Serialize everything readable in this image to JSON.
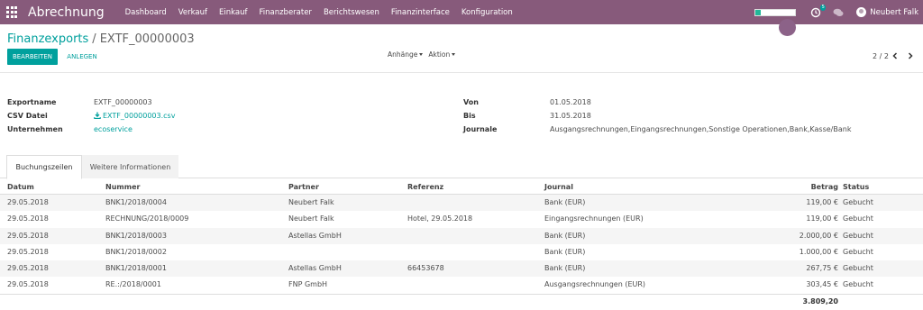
{
  "navbar": {
    "app_title": "Abrechnung",
    "menu": [
      "Dashboard",
      "Verkauf",
      "Einkauf",
      "Finanzberater",
      "Berichtswesen",
      "Finanzinterface",
      "Konfiguration"
    ],
    "activity_badge": "5",
    "progress_fraction": 0.12,
    "user_name": "Neubert Falk",
    "color": "#875a7b"
  },
  "breadcrumb": {
    "parent": "Finanzexports",
    "separator": "/",
    "current": "EXTF_00000003"
  },
  "buttons": {
    "edit": "BEARBEITEN",
    "create": "ANLEGEN"
  },
  "dropdowns": {
    "attachments": "Anhänge",
    "action": "Aktion"
  },
  "pager": {
    "value": "2 / 2"
  },
  "form": {
    "left": [
      {
        "label": "Exportname",
        "value": "EXTF_00000003"
      },
      {
        "label": "CSV Datei",
        "value": "EXTF_00000003.csv"
      },
      {
        "label": "Unternehmen",
        "value": "ecoservice"
      }
    ],
    "right": [
      {
        "label": "Von",
        "value": "01.05.2018"
      },
      {
        "label": "Bis",
        "value": "31.05.2018"
      },
      {
        "label": "Journale",
        "value": "Ausgangsrechnungen,Eingangsrechnungen,Sonstige Operationen,Bank,Kasse/Bank"
      }
    ]
  },
  "tabs": [
    "Buchungszeilen",
    "Weitere Informationen"
  ],
  "table": {
    "headers": {
      "datum": "Datum",
      "nummer": "Nummer",
      "partner": "Partner",
      "referenz": "Referenz",
      "journal": "Journal",
      "betrag": "Betrag",
      "status": "Status"
    },
    "rows": [
      {
        "datum": "29.05.2018",
        "nummer": "BNK1/2018/0004",
        "partner": "Neubert Falk",
        "referenz": "",
        "journal": "Bank (EUR)",
        "betrag": "119,00 €",
        "status": "Gebucht"
      },
      {
        "datum": "29.05.2018",
        "nummer": "RECHNUNG/2018/0009",
        "partner": "Neubert Falk",
        "referenz": "Hotel, 29.05.2018",
        "journal": "Eingangsrechnungen (EUR)",
        "betrag": "119,00 €",
        "status": "Gebucht"
      },
      {
        "datum": "29.05.2018",
        "nummer": "BNK1/2018/0003",
        "partner": "Astellas GmbH",
        "referenz": "",
        "journal": "Bank (EUR)",
        "betrag": "2.000,00 €",
        "status": "Gebucht"
      },
      {
        "datum": "29.05.2018",
        "nummer": "BNK1/2018/0002",
        "partner": "",
        "referenz": "",
        "journal": "Bank (EUR)",
        "betrag": "1.000,00 €",
        "status": "Gebucht"
      },
      {
        "datum": "29.05.2018",
        "nummer": "BNK1/2018/0001",
        "partner": "Astellas GmbH",
        "referenz": "66453678",
        "journal": "Bank (EUR)",
        "betrag": "267,75 €",
        "status": "Gebucht"
      },
      {
        "datum": "29.05.2018",
        "nummer": "RE.:/2018/0001",
        "partner": "FNP GmbH",
        "referenz": "",
        "journal": "Ausgangsrechnungen (EUR)",
        "betrag": "303,45 €",
        "status": "Gebucht"
      }
    ],
    "total": "3.809,20"
  }
}
